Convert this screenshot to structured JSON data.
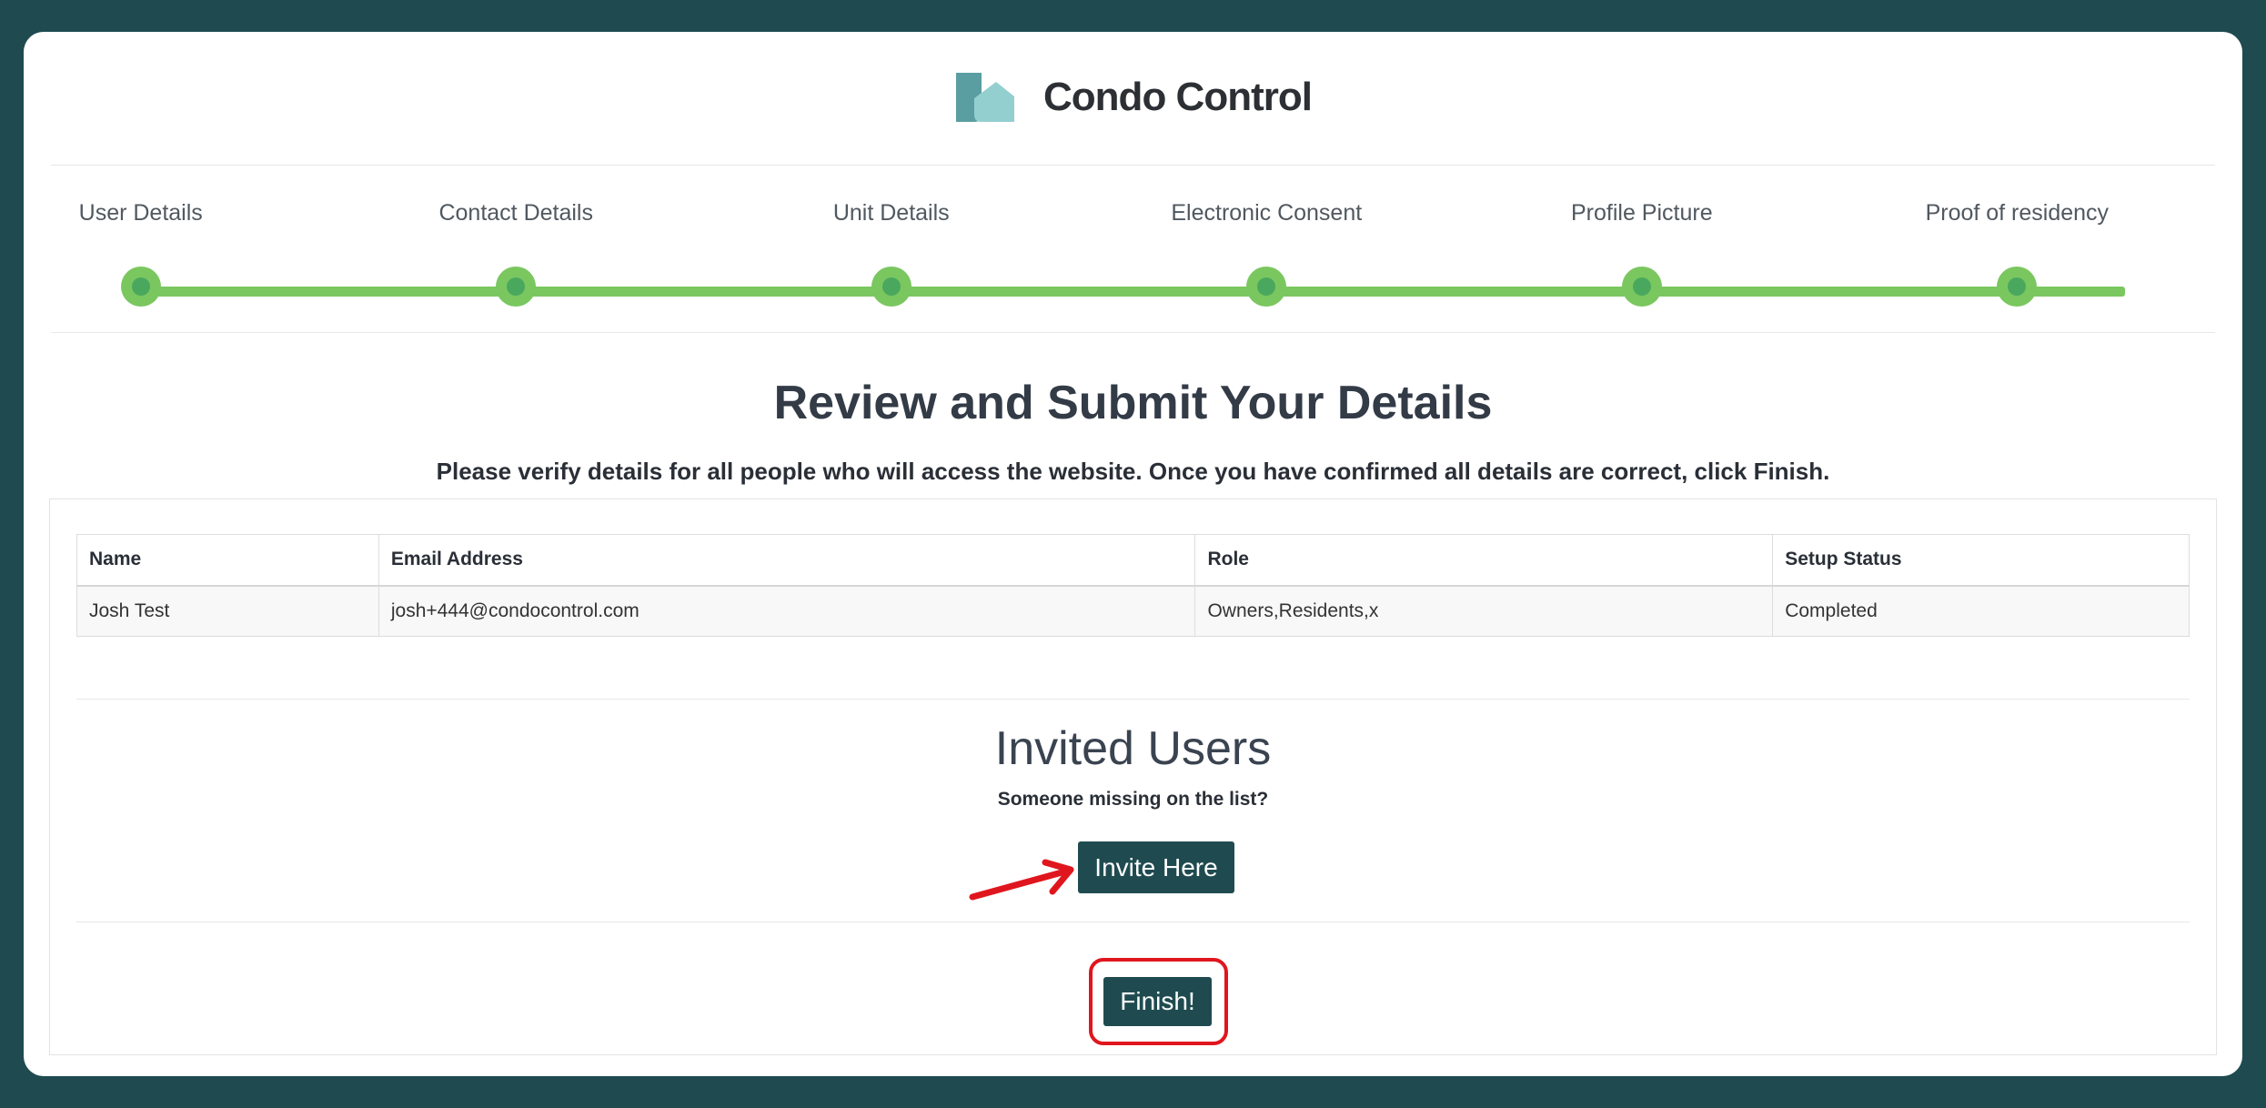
{
  "brand": {
    "name": "Condo Control",
    "logo_icon": "building-logo-icon",
    "colors": {
      "logo_dark": "#5a9ea2",
      "logo_light": "#94cfd0"
    }
  },
  "stepper": {
    "steps": [
      {
        "label": "User Details",
        "state": "completed"
      },
      {
        "label": "Contact Details",
        "state": "completed"
      },
      {
        "label": "Unit Details",
        "state": "completed"
      },
      {
        "label": "Electronic Consent",
        "state": "completed"
      },
      {
        "label": "Profile Picture",
        "state": "completed"
      },
      {
        "label": "Proof of residency",
        "state": "completed"
      }
    ],
    "colors": {
      "track": "#7ac760",
      "dot_center": "#4aa85e"
    }
  },
  "page": {
    "title": "Review and Submit Your Details",
    "subtitle": "Please verify details for all people who will access the website. Once you have confirmed all details are correct, click Finish."
  },
  "users_table": {
    "headers": [
      "Name",
      "Email Address",
      "Role",
      "Setup Status"
    ],
    "rows": [
      [
        "Josh Test",
        "josh+444@condocontrol.com",
        "Owners,Residents,x",
        "Completed"
      ]
    ]
  },
  "invited": {
    "title": "Invited Users",
    "prompt": "Someone missing on the list?",
    "invite_label": "Invite Here"
  },
  "actions": {
    "finish_label": "Finish!"
  },
  "annotations": {
    "arrow_icon": "red-arrow-icon",
    "highlight_color": "#e0161e"
  },
  "theme": {
    "background": "#1f4b50",
    "button": "#1f4b50"
  }
}
